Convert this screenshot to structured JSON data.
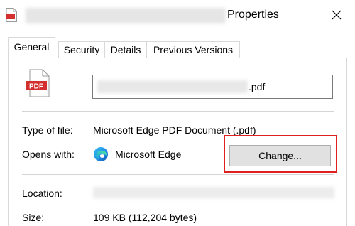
{
  "window": {
    "title_suffix": "Properties",
    "close_symbol": "✕"
  },
  "tabs": [
    {
      "label": "General",
      "active": true
    },
    {
      "label": "Security",
      "active": false
    },
    {
      "label": "Details",
      "active": false
    },
    {
      "label": "Previous Versions",
      "active": false
    }
  ],
  "file": {
    "icon": "pdf-icon",
    "icon_badge": "PDF",
    "name_extension": ".pdf"
  },
  "details": {
    "type_label": "Type of file:",
    "type_value": "Microsoft Edge PDF Document (.pdf)",
    "opens_label": "Opens with:",
    "opens_app": "Microsoft Edge",
    "change_button": "Change...",
    "location_label": "Location:",
    "size_label": "Size:",
    "size_value": "109 KB (112,204 bytes)"
  },
  "colors": {
    "highlight": "#e01f1f",
    "pdf_red": "#d32f2f",
    "tab_border": "#d9d9d9"
  }
}
